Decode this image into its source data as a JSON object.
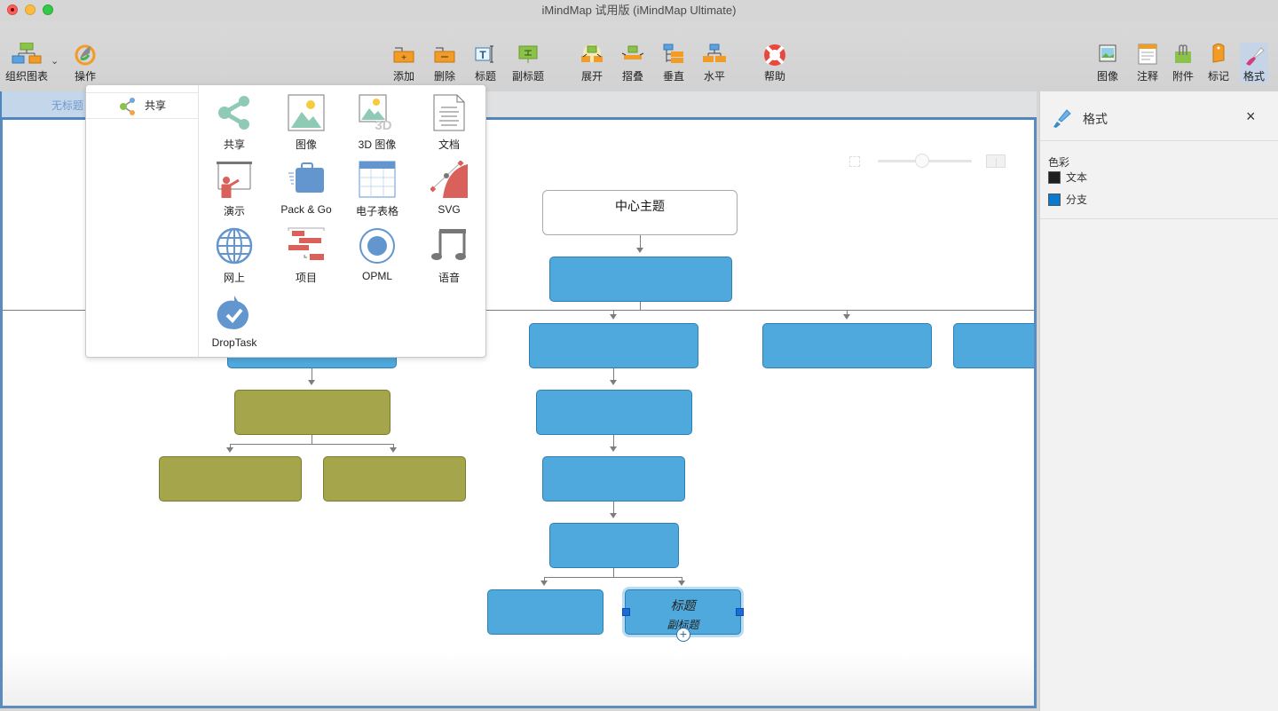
{
  "window": {
    "title": "iMindMap 试用版 (iMindMap Ultimate)"
  },
  "toolbar": {
    "left": [
      {
        "id": "org-chart",
        "label": "组织图表",
        "icon": "org-chart-icon"
      },
      {
        "id": "actions",
        "label": "操作",
        "icon": "rocket-icon"
      }
    ],
    "center": [
      {
        "id": "add",
        "label": "添加",
        "icon": "add-branch-icon"
      },
      {
        "id": "delete",
        "label": "删除",
        "icon": "delete-branch-icon"
      },
      {
        "id": "title",
        "label": "标题",
        "icon": "title-text-icon"
      },
      {
        "id": "subtitle",
        "label": "副标题",
        "icon": "subtitle-icon"
      },
      {
        "id": "expand",
        "label": "展开",
        "icon": "expand-icon"
      },
      {
        "id": "collapse",
        "label": "摺叠",
        "icon": "collapse-icon"
      },
      {
        "id": "vertical",
        "label": "垂直",
        "icon": "vertical-layout-icon"
      },
      {
        "id": "horizontal",
        "label": "水平",
        "icon": "horizontal-layout-icon"
      },
      {
        "id": "help",
        "label": "帮助",
        "icon": "lifebuoy-icon"
      }
    ],
    "right": [
      {
        "id": "image",
        "label": "图像",
        "icon": "image-icon"
      },
      {
        "id": "notes",
        "label": "注释",
        "icon": "notes-icon"
      },
      {
        "id": "attachments",
        "label": "附件",
        "icon": "attachment-icon"
      },
      {
        "id": "markers",
        "label": "标记",
        "icon": "tag-icon"
      },
      {
        "id": "format",
        "label": "格式",
        "icon": "paintbrush-icon",
        "active": true
      }
    ]
  },
  "tabs": [
    {
      "label": "无标题",
      "active": true
    }
  ],
  "share_popover": {
    "category": "共享",
    "items": [
      {
        "label": "共享",
        "icon": "share-icon"
      },
      {
        "label": "图像",
        "icon": "image-export-icon"
      },
      {
        "label": "3D 图像",
        "icon": "image-3d-icon"
      },
      {
        "label": "文档",
        "icon": "document-icon"
      },
      {
        "label": "演示",
        "icon": "presentation-icon"
      },
      {
        "label": "Pack & Go",
        "icon": "suitcase-icon"
      },
      {
        "label": "电子表格",
        "icon": "spreadsheet-icon"
      },
      {
        "label": "SVG",
        "icon": "svg-icon"
      },
      {
        "label": "网上",
        "icon": "globe-icon"
      },
      {
        "label": "项目",
        "icon": "gantt-icon"
      },
      {
        "label": "OPML",
        "icon": "opml-icon"
      },
      {
        "label": "语音",
        "icon": "music-note-icon"
      },
      {
        "label": "DropTask",
        "icon": "droptask-icon"
      }
    ]
  },
  "canvas": {
    "central_topic": "中心主题",
    "selected_node": {
      "title": "标题",
      "subtitle": "副标题"
    }
  },
  "format_panel": {
    "title": "格式",
    "close": "×",
    "section_label": "色彩",
    "colors": [
      {
        "label": "文本",
        "color": "#1e1e1e"
      },
      {
        "label": "分支",
        "color": "#0a7ad0"
      }
    ]
  },
  "colors": {
    "branch_blue": "#4fa9dc",
    "branch_olive": "#a5a64b",
    "accent": "#4f86c0"
  }
}
